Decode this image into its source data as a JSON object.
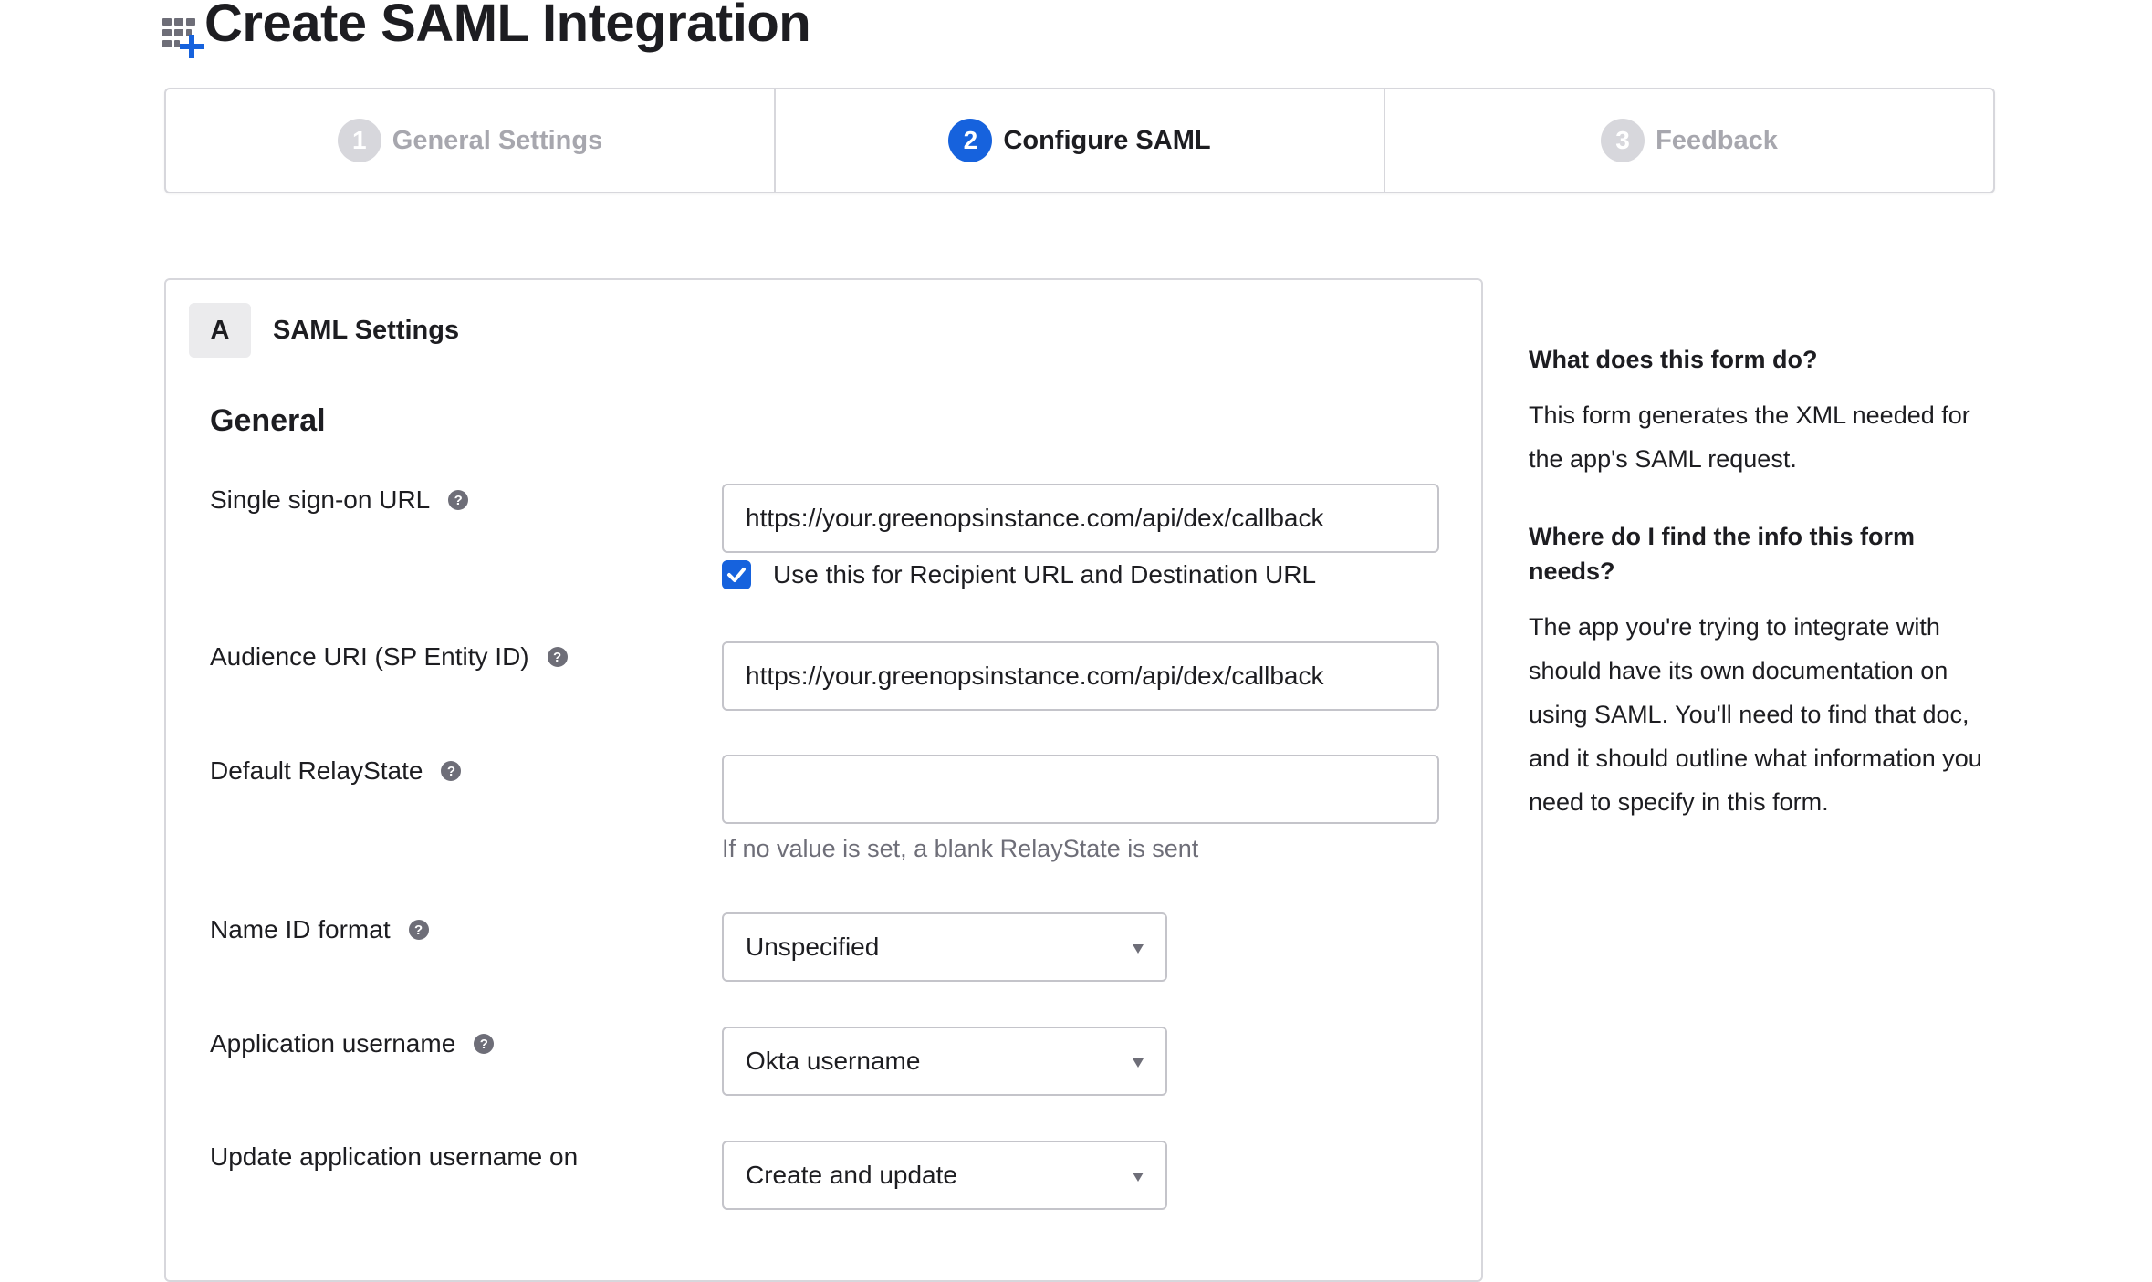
{
  "page": {
    "title": "Create SAML Integration",
    "icon": "grid-plus-icon"
  },
  "stepper": {
    "steps": [
      {
        "number": "1",
        "label": "General Settings",
        "state": "completed"
      },
      {
        "number": "2",
        "label": "Configure SAML",
        "state": "active"
      },
      {
        "number": "3",
        "label": "Feedback",
        "state": "upcoming"
      }
    ]
  },
  "section": {
    "badge": "A",
    "title": "SAML Settings",
    "group_title": "General",
    "fields": {
      "sso_url": {
        "label": "Single sign-on URL",
        "value": "https://your.greenopsinstance.com/api/dex/callback",
        "checkbox_label": "Use this for Recipient URL and Destination URL",
        "checkbox_checked": true
      },
      "audience_uri": {
        "label": "Audience URI (SP Entity ID)",
        "value": "https://your.greenopsinstance.com/api/dex/callback"
      },
      "relay_state": {
        "label": "Default RelayState",
        "value": "",
        "hint": "If no value is set, a blank RelayState is sent"
      },
      "name_id_format": {
        "label": "Name ID format",
        "selected": "Unspecified"
      },
      "app_username": {
        "label": "Application username",
        "selected": "Okta username"
      },
      "update_username_on": {
        "label": "Update application username on",
        "selected": "Create and update"
      }
    },
    "help_glyph": "?"
  },
  "help": {
    "q1": "What does this form do?",
    "a1": "This form generates the XML needed for the app's SAML request.",
    "q2": "Where do I find the info this form needs?",
    "a2": "The app you're trying to integrate with should have its own documentation on using SAML. You'll need to find that doc, and it should outline what information you need to specify in this form."
  },
  "colors": {
    "accent": "#1662dd",
    "inactive_step": "#d7d7dc",
    "help_icon": "#6e6e78"
  }
}
